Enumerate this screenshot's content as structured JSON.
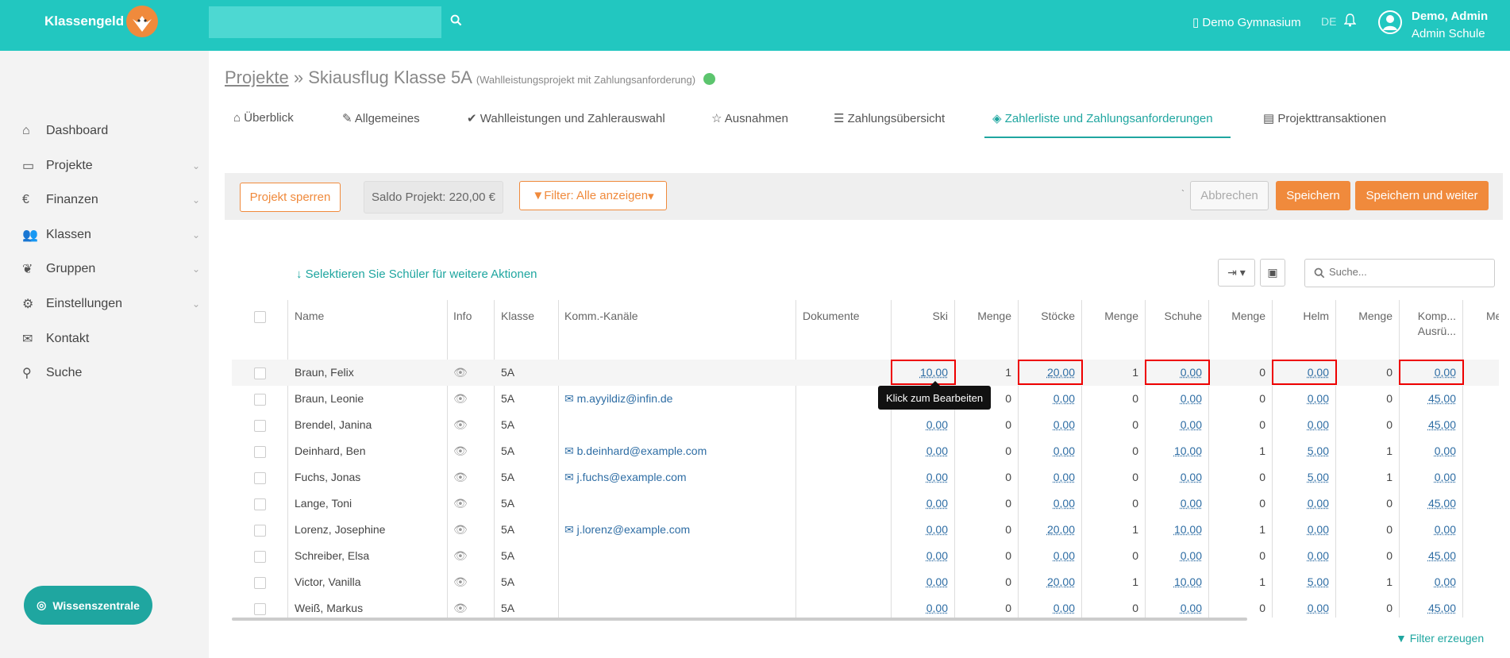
{
  "header": {
    "app_name": "Klassengeld",
    "search_placeholder": "",
    "school": "Demo Gymnasium",
    "lang": "DE",
    "user_name": "Demo, Admin",
    "user_role": "Admin Schule",
    "accent": "#22c7c0"
  },
  "sidebar": {
    "items": [
      {
        "label": "Dashboard",
        "icon": "home-icon"
      },
      {
        "label": "Projekte",
        "icon": "credit-card-icon"
      },
      {
        "label": "Finanzen",
        "icon": "euro-icon"
      },
      {
        "label": "Klassen",
        "icon": "users-icon"
      },
      {
        "label": "Gruppen",
        "icon": "leaf-icon"
      },
      {
        "label": "Einstellungen",
        "icon": "gear-icon"
      },
      {
        "label": "Kontakt",
        "icon": "envelope-icon"
      },
      {
        "label": "Suche",
        "icon": "search-icon"
      }
    ],
    "knowledge": "Wissenszentrale"
  },
  "breadcrumb": {
    "root": "Projekte",
    "sep": "»",
    "title": "Skiausflug Klasse 5A",
    "subtitle": "(Wahlleistungsprojekt mit Zahlungsanforderung)"
  },
  "tabs": [
    {
      "label": "Überblick",
      "icon": "home-icon"
    },
    {
      "label": "Allgemeines",
      "icon": "pencil-icon"
    },
    {
      "label": "Wahlleistungen und Zahlerauswahl",
      "icon": "check-icon"
    },
    {
      "label": "Ausnahmen",
      "icon": "star-icon"
    },
    {
      "label": "Zahlungsübersicht",
      "icon": "tasks-icon"
    },
    {
      "label": "Zahlerliste und Zahlungsanforderungen",
      "icon": "cube-icon"
    },
    {
      "label": "Projekttransaktionen",
      "icon": "list-icon"
    }
  ],
  "actions": {
    "lock": "Projekt sperren",
    "saldo": "Saldo Projekt: 220,00 €",
    "filter": "Filter: Alle anzeigen",
    "tick": "`",
    "cancel": "Abbrechen",
    "save": "Speichern",
    "save_next": "Speichern und weiter",
    "accent": "#f08a3c"
  },
  "table_tools": {
    "select_hint": "Selektieren Sie Schüler für weitere Aktionen",
    "search_placeholder": "Suche...",
    "filter_create": "Filter erzeugen"
  },
  "columns": [
    "Name",
    "Info",
    "Klasse",
    "Komm.-Kanäle",
    "Dokumente",
    "Ski",
    "Menge",
    "Stöcke",
    "Menge",
    "Schuhe",
    "Menge",
    "Helm",
    "Menge",
    "Komp...",
    "Ausrü...",
    "Me"
  ],
  "rows": [
    {
      "name": "Braun, Felix",
      "klasse": "5A",
      "mail": "",
      "ski": "10,00",
      "m1": "1",
      "stoecke": "20,00",
      "m2": "1",
      "schuhe": "0,00",
      "m3": "0",
      "helm": "0,00",
      "m4": "0",
      "komp": "0,00"
    },
    {
      "name": "Braun, Leonie",
      "klasse": "5A",
      "mail": "m.ayyildiz@infin.de",
      "ski": "",
      "m1": "0",
      "stoecke": "0,00",
      "m2": "0",
      "schuhe": "0,00",
      "m3": "0",
      "helm": "0,00",
      "m4": "0",
      "komp": "45,00"
    },
    {
      "name": "Brendel, Janina",
      "klasse": "5A",
      "mail": "",
      "ski": "0,00",
      "m1": "0",
      "stoecke": "0,00",
      "m2": "0",
      "schuhe": "0,00",
      "m3": "0",
      "helm": "0,00",
      "m4": "0",
      "komp": "45,00"
    },
    {
      "name": "Deinhard, Ben",
      "klasse": "5A",
      "mail": "b.deinhard@example.com",
      "ski": "0,00",
      "m1": "0",
      "stoecke": "0,00",
      "m2": "0",
      "schuhe": "10,00",
      "m3": "1",
      "helm": "5,00",
      "m4": "1",
      "komp": "0,00"
    },
    {
      "name": "Fuchs, Jonas",
      "klasse": "5A",
      "mail": "j.fuchs@example.com",
      "ski": "0,00",
      "m1": "0",
      "stoecke": "0,00",
      "m2": "0",
      "schuhe": "0,00",
      "m3": "0",
      "helm": "5,00",
      "m4": "1",
      "komp": "0,00"
    },
    {
      "name": "Lange, Toni",
      "klasse": "5A",
      "mail": "",
      "ski": "0,00",
      "m1": "0",
      "stoecke": "0,00",
      "m2": "0",
      "schuhe": "0,00",
      "m3": "0",
      "helm": "0,00",
      "m4": "0",
      "komp": "45,00"
    },
    {
      "name": "Lorenz, Josephine",
      "klasse": "5A",
      "mail": "j.lorenz@example.com",
      "ski": "0,00",
      "m1": "0",
      "stoecke": "20,00",
      "m2": "1",
      "schuhe": "10,00",
      "m3": "1",
      "helm": "0,00",
      "m4": "0",
      "komp": "0,00"
    },
    {
      "name": "Schreiber, Elsa",
      "klasse": "5A",
      "mail": "",
      "ski": "0,00",
      "m1": "0",
      "stoecke": "0,00",
      "m2": "0",
      "schuhe": "0,00",
      "m3": "0",
      "helm": "0,00",
      "m4": "0",
      "komp": "45,00"
    },
    {
      "name": "Victor, Vanilla",
      "klasse": "5A",
      "mail": "",
      "ski": "0,00",
      "m1": "0",
      "stoecke": "20,00",
      "m2": "1",
      "schuhe": "10,00",
      "m3": "1",
      "helm": "5,00",
      "m4": "1",
      "komp": "0,00"
    },
    {
      "name": "Weiß, Markus",
      "klasse": "5A",
      "mail": "",
      "ski": "0,00",
      "m1": "0",
      "stoecke": "0,00",
      "m2": "0",
      "schuhe": "0,00",
      "m3": "0",
      "helm": "0,00",
      "m4": "0",
      "komp": "45,00"
    }
  ],
  "tooltip": "Klick zum Bearbeiten"
}
